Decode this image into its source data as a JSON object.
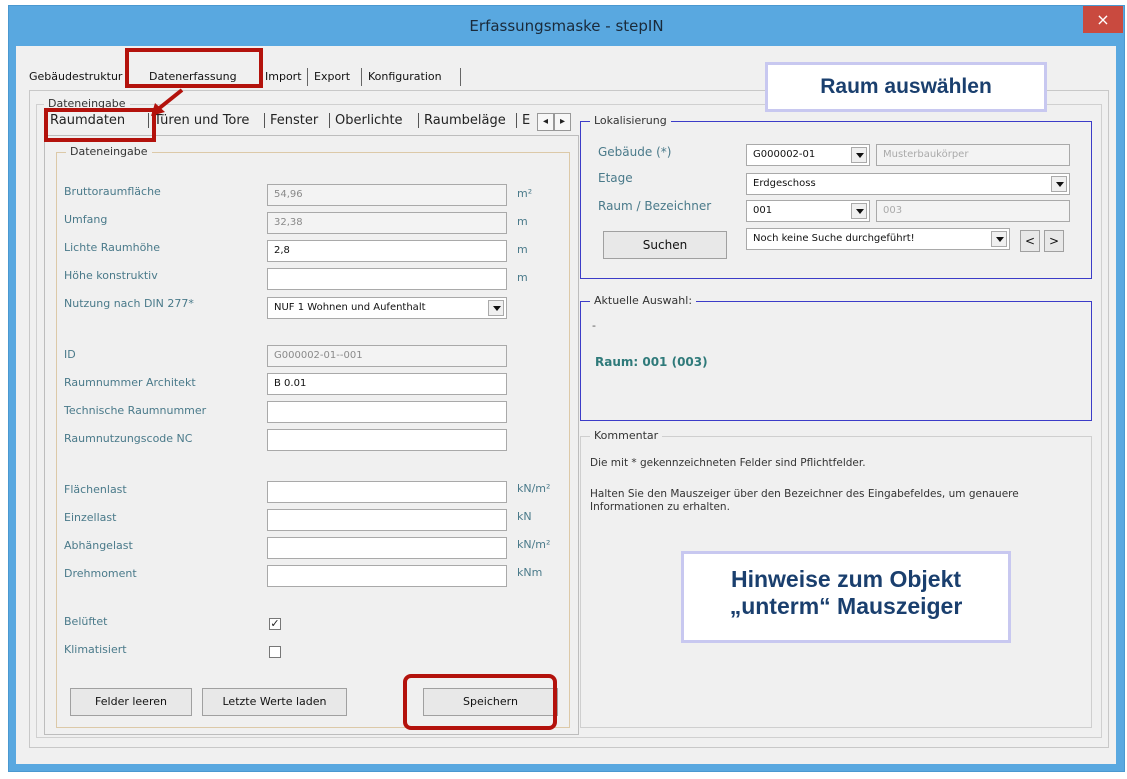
{
  "window": {
    "title": "Erfassungsmaske - stepIN",
    "close_glyph": "×"
  },
  "main_tabs": [
    "Gebäudestruktur",
    "Datenerfassung",
    "Import",
    "Export",
    "Konfiguration"
  ],
  "outer_group_label": "Dateneingabe",
  "sub_tabs": [
    "Raumdaten",
    "Türen und Tore",
    "Fenster",
    "Oberlichte",
    "Raumbeläge",
    "E"
  ],
  "sub_tab_nav": {
    "prev": "◂",
    "next": "▸"
  },
  "data_group": {
    "label": "Dateneingabe",
    "fields": [
      {
        "label": "Bruttoraumfläche",
        "value": "54,96",
        "unit": "m²"
      },
      {
        "label": "Umfang",
        "value": "32,38",
        "unit": "m"
      },
      {
        "label": "Lichte Raumhöhe",
        "value": "2,8",
        "unit": "m"
      },
      {
        "label": "Höhe konstruktiv",
        "value": "",
        "unit": "m"
      },
      {
        "label": "Nutzung nach DIN 277*",
        "value": "NUF 1 Wohnen und Aufenthalt",
        "unit": ""
      },
      {
        "label": "ID",
        "value": "G000002-01--001",
        "unit": ""
      },
      {
        "label": "Raumnummer Architekt",
        "value": "B 0.01",
        "unit": ""
      },
      {
        "label": "Technische Raumnummer",
        "value": "",
        "unit": ""
      },
      {
        "label": "Raumnutzungscode NC",
        "value": "",
        "unit": ""
      },
      {
        "label": "Flächenlast",
        "value": "",
        "unit": "kN/m²"
      },
      {
        "label": "Einzellast",
        "value": "",
        "unit": "kN"
      },
      {
        "label": "Abhängelast",
        "value": "",
        "unit": "kN/m²"
      },
      {
        "label": "Drehmoment",
        "value": "",
        "unit": "kNm"
      }
    ],
    "checkboxes": [
      {
        "label": "Belüftet",
        "checked": true,
        "mark": "✓"
      },
      {
        "label": "Klimatisiert",
        "checked": false,
        "mark": ""
      }
    ],
    "buttons": {
      "clear": "Felder leeren",
      "load_last": "Letzte Werte laden",
      "save": "Speichern"
    }
  },
  "localization": {
    "label": "Lokalisierung",
    "gebaeude_label": "Gebäude (*)",
    "gebaeude_value": "G000002-01",
    "gebaeude_name": "Musterbaukörper",
    "etage_label": "Etage",
    "etage_value": "Erdgeschoss",
    "raum_label": "Raum / Bezeichner",
    "raum_value": "001",
    "raum_name": "003",
    "search_button": "Suchen",
    "search_status": "Noch keine Suche durchgeführt!",
    "prev": "<",
    "next": ">"
  },
  "selection": {
    "label": "Aktuelle Auswahl:",
    "dash": "-",
    "value": "Raum: 001 (003)"
  },
  "comment": {
    "label": "Kommentar",
    "line1": "Die mit * gekennzeichneten Felder sind Pflichtfelder.",
    "line2": "Halten Sie den Mauszeiger über den Bezeichner des Eingabefeldes, um genauere Informationen zu erhalten."
  },
  "annotations": {
    "raum": "Raum auswählen",
    "hint_line1": "Hinweise zum Objekt",
    "hint_line2": "„unterm“ Mauszeiger"
  },
  "colors": {
    "title_bar": "#59a8e0",
    "close": "#c94a3f",
    "highlight": "#b3120c",
    "annotation_text": "#1a3f6e",
    "selection_text": "#2f7a7a",
    "group_border_blue": "#3c3cc8"
  }
}
